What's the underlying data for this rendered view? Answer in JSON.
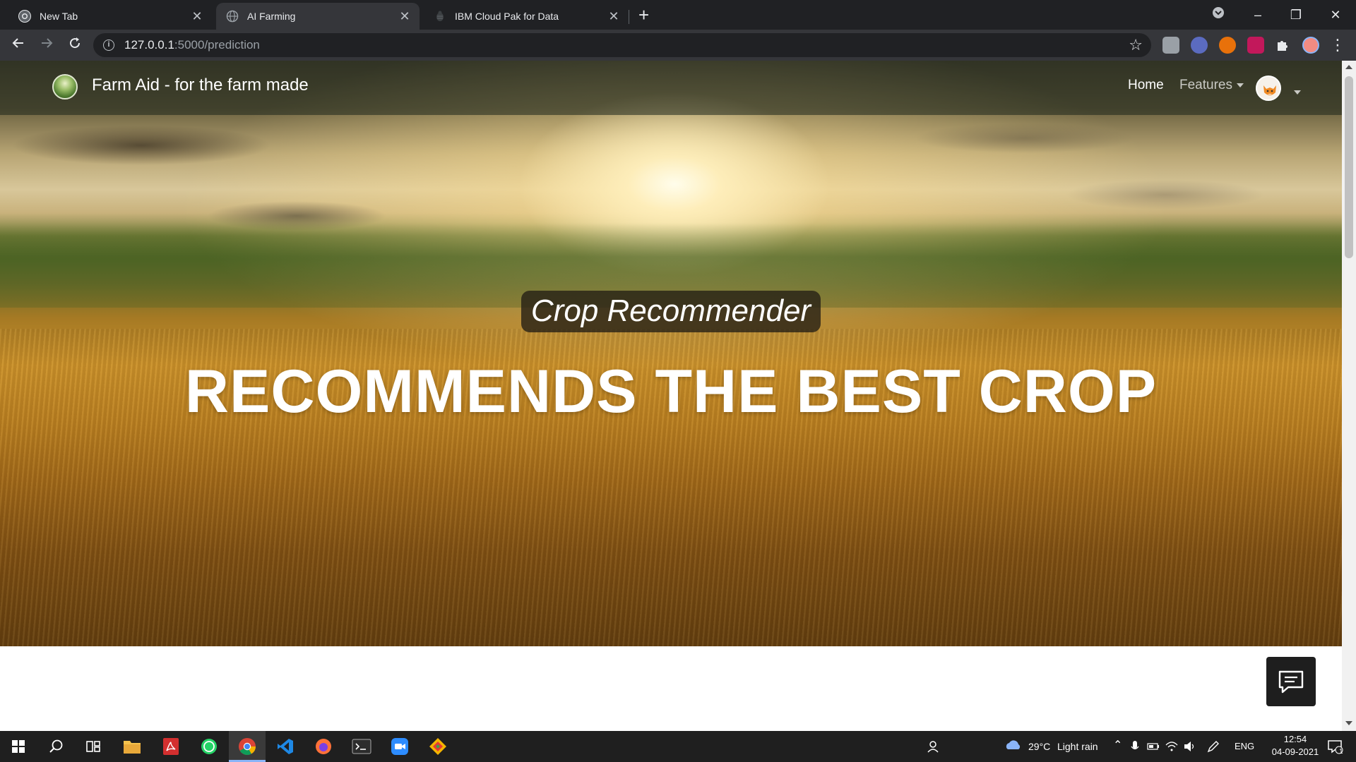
{
  "browser": {
    "tabs": [
      {
        "title": "New Tab",
        "active": false
      },
      {
        "title": "AI Farming",
        "active": true
      },
      {
        "title": "IBM Cloud Pak for Data",
        "active": false
      }
    ],
    "url_host": "127.0.0.1",
    "url_path": ":5000/prediction"
  },
  "navbar": {
    "brand": "Farm Aid - for the farm made",
    "home": "Home",
    "features": "Features"
  },
  "hero": {
    "subtitle": "Crop Recommender",
    "headline": "RECOMMENDS THE BEST CROP"
  },
  "taskbar": {
    "weather_temp": "29°C",
    "weather_desc": "Light rain",
    "language": "ENG",
    "time": "12:54",
    "date": "04-09-2021",
    "notification_count": "1"
  },
  "colors": {
    "chrome_dark": "#202124",
    "chrome_toolbar": "#35363a",
    "taskbar": "#1f1f1f",
    "accent": "#8ab4f8"
  }
}
